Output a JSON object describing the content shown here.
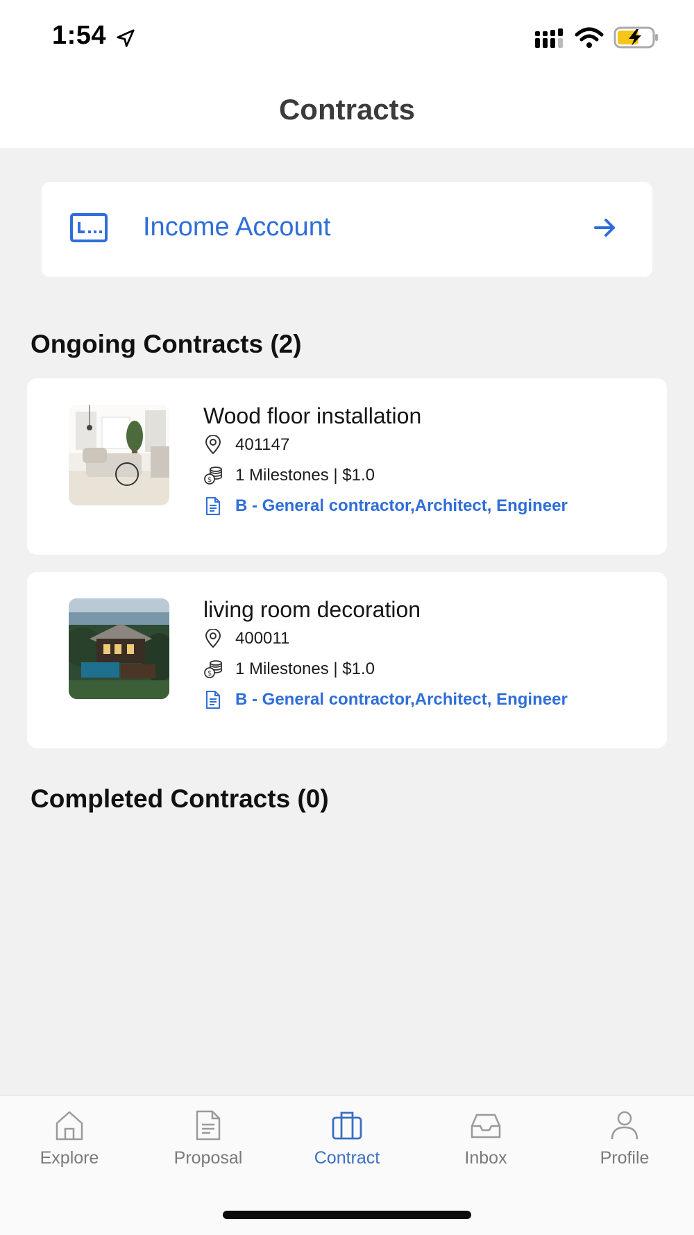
{
  "status_bar": {
    "time": "1:54"
  },
  "header": {
    "title": "Contracts"
  },
  "income": {
    "label": "Income Account"
  },
  "ongoing": {
    "title": "Ongoing Contracts (2)",
    "items": [
      {
        "title": "Wood floor installation",
        "zip": "401147",
        "milestones": "1 Milestones | $1.0",
        "category": "B - General contractor,Architect, Engineer"
      },
      {
        "title": "living room decoration",
        "zip": "400011",
        "milestones": "1 Milestones | $1.0",
        "category": "B - General contractor,Architect, Engineer"
      }
    ]
  },
  "completed": {
    "title": "Completed Contracts (0)"
  },
  "tabs": [
    {
      "label": "Explore",
      "icon": "home-icon"
    },
    {
      "label": "Proposal",
      "icon": "document-icon"
    },
    {
      "label": "Contract",
      "icon": "briefcase-icon",
      "active": true
    },
    {
      "label": "Inbox",
      "icon": "inbox-icon"
    },
    {
      "label": "Profile",
      "icon": "person-icon"
    }
  ],
  "colors": {
    "accent": "#2f6ed8",
    "background": "#f1f1f1",
    "battery": "#f5c518"
  }
}
